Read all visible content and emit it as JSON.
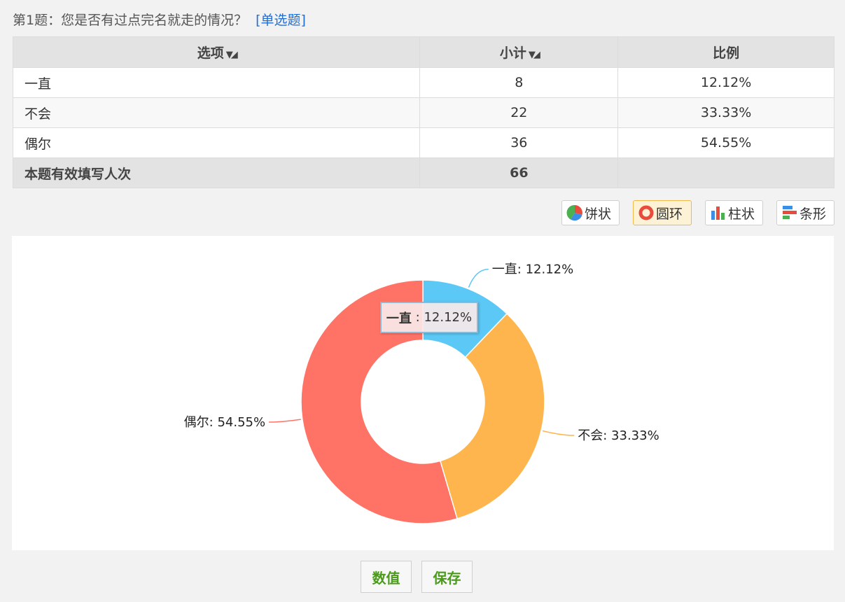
{
  "question": {
    "title": "第1题：您是否有过点完名就走的情况？",
    "type": "[单选题]"
  },
  "table": {
    "headers": {
      "option": "选项",
      "count": "小计",
      "ratio": "比例"
    },
    "rows": [
      {
        "option": "一直",
        "count": "8",
        "ratio": "12.12%"
      },
      {
        "option": "不会",
        "count": "22",
        "ratio": "33.33%"
      },
      {
        "option": "偶尔",
        "count": "36",
        "ratio": "54.55%"
      }
    ],
    "footer": {
      "label": "本题有效填写人次",
      "count": "66",
      "ratio": ""
    }
  },
  "chart_switch": {
    "pie": "饼状",
    "ring": "圆环",
    "bar": "柱状",
    "hbar": "条形",
    "active": "ring"
  },
  "chart_data": {
    "type": "pie",
    "variant": "donut",
    "categories": [
      "一直",
      "不会",
      "偶尔"
    ],
    "values": [
      12.12,
      33.33,
      54.55
    ],
    "labels": [
      "一直: 12.12%",
      "不会: 33.33%",
      "偶尔: 54.55%"
    ],
    "colors": [
      "#5bc8f5",
      "#ffb54d",
      "#ff7366"
    ],
    "tooltip": {
      "name": "一直",
      "value": "12.12%"
    }
  },
  "buttons": {
    "values": "数值",
    "save": "保存"
  }
}
